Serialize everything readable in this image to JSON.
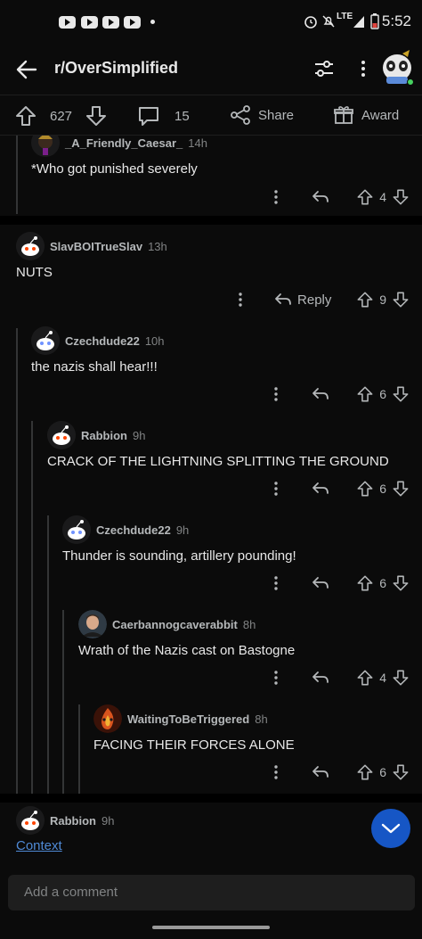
{
  "status_bar": {
    "time": "5:52",
    "network": "LTE",
    "icons": [
      "youtube-icon",
      "youtube-icon",
      "youtube-icon",
      "youtube-icon",
      "alarm-icon",
      "mute-icon",
      "signal-icon",
      "battery-icon"
    ]
  },
  "header": {
    "subreddit": "r/OverSimplified"
  },
  "post_actions": {
    "score": "627",
    "comments": "15",
    "share_label": "Share",
    "award_label": "Award"
  },
  "comments": [
    {
      "author": "_A_Friendly_Caesar_",
      "age": "14h",
      "body": "*Who got punished severely",
      "votes": "4",
      "depth": 1,
      "avatar": "caesar-avatar"
    },
    {
      "author": "SlavBOITrueSlav",
      "age": "13h",
      "body": "NUTS",
      "votes": "9",
      "depth": 0,
      "reply_label": "Reply",
      "avatar": "snoo-avatar"
    },
    {
      "author": "Czechdude22",
      "age": "10h",
      "body": "the nazis shall hear!!!",
      "votes": "6",
      "depth": 1,
      "avatar": "snoo-avatar"
    },
    {
      "author": "Rabbion",
      "age": "9h",
      "body": "CRACK OF THE LIGHTNING SPLITTING THE GROUND",
      "votes": "6",
      "depth": 2,
      "avatar": "snoo-avatar"
    },
    {
      "author": "Czechdude22",
      "age": "9h",
      "body": "Thunder is sounding, artillery pounding!",
      "votes": "6",
      "depth": 3,
      "avatar": "snoo-avatar"
    },
    {
      "author": "Caerbannogcaverabbit",
      "age": "8h",
      "body": "Wrath of the Nazis cast on Bastogne",
      "votes": "4",
      "depth": 4,
      "avatar": "photo-avatar"
    },
    {
      "author": "WaitingToBeTriggered",
      "age": "8h",
      "body": "FACING THEIR FORCES ALONE",
      "votes": "6",
      "depth": 5,
      "avatar": "fire-avatar"
    }
  ],
  "bottom_comment": {
    "author": "Rabbion",
    "age": "9h",
    "context_label": "Context"
  },
  "composer": {
    "placeholder": "Add a comment"
  },
  "colors": {
    "background": "#0b0b0b",
    "accent": "#1656c5",
    "link": "#4f8ad6"
  }
}
